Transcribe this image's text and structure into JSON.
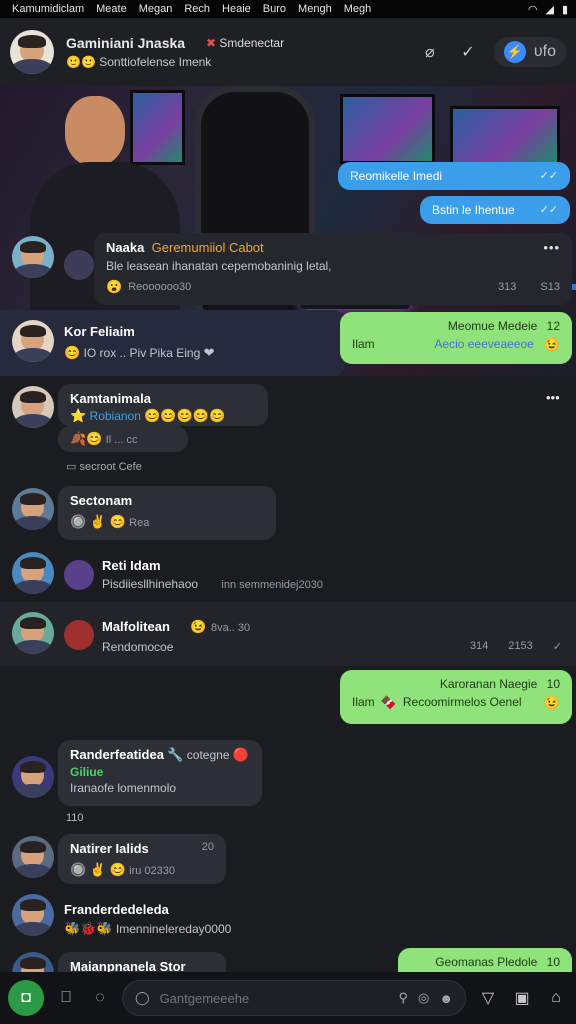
{
  "status": {
    "menus": [
      "Kamumidiclam",
      "Meate",
      "Megan",
      "Rech",
      "Heaie",
      "Buro",
      "Mengh",
      "Megh"
    ],
    "wifi": "wifi-icon",
    "battery": "battery-icon"
  },
  "header": {
    "title": "Gaminiani Jnaska",
    "subtitle": "Sonttiofelense Imenk",
    "mid_title": "Smdenectar",
    "pill_label": "ᴜfo"
  },
  "messages": {
    "out1": {
      "text": "Reomikelle Imedi",
      "ticks": "✓✓"
    },
    "out2": {
      "text": "Bstin le Ihentue",
      "ticks": "✓✓"
    },
    "card": {
      "name": "Naaka",
      "group": "Geremumiiol Cabot",
      "text": "Ble leasean ihanatan cepemobaninig letal,",
      "reactions": "Reoooooo30",
      "time1": "313",
      "time2": "S13",
      "more": "•••"
    },
    "kor": {
      "name": "Kor Feliaim",
      "text": "IO rox .. Piv Pika Eing",
      "reply_title": "Meomue Medeie",
      "reply_time": "12",
      "reply_text": "Ilam",
      "reply_link": "Aecio eeeveaeeoe"
    },
    "kam": {
      "name": "Kamtanimala",
      "tag": "Robianon",
      "meta": "Il ... cc",
      "footnote": "secroot Cefe",
      "more": "•••"
    },
    "sect": {
      "name": "Sectonam",
      "text": "Rea"
    },
    "reti": {
      "name": "Reti Idam",
      "text": "Pisdiiesllhinehaoo",
      "extra": "inn semmenidej2030"
    },
    "mal": {
      "name": "Malfolitean",
      "text": "Rendomocoe",
      "extra": "8va.. 30",
      "t1": "314",
      "t2": "2153"
    },
    "out3": {
      "title": "Karoranan Naegie",
      "time": "10",
      "text": "Ilam",
      "sub": "Recoomirmelos Oenel"
    },
    "rand": {
      "name": "Randerfeatidea",
      "badge": "cotegne",
      "status": "Giliue",
      "text": "Iranaofe lomenmolo",
      "count": "110"
    },
    "nat": {
      "name": "Natirer Ialids",
      "num": "20",
      "text": "iru 02330"
    },
    "fran": {
      "name": "Franderdedeleda",
      "text": "Imenninelereday0000"
    },
    "mai": {
      "name": "Maianpnanela Stor",
      "reply": "Geomanas Pledole",
      "time": "10"
    }
  },
  "compose": {
    "placeholder": "Gantgemeeehe"
  },
  "colors": {
    "blue": "#3a9eea",
    "green": "#8fe37a",
    "bg": "#1b1c20"
  }
}
